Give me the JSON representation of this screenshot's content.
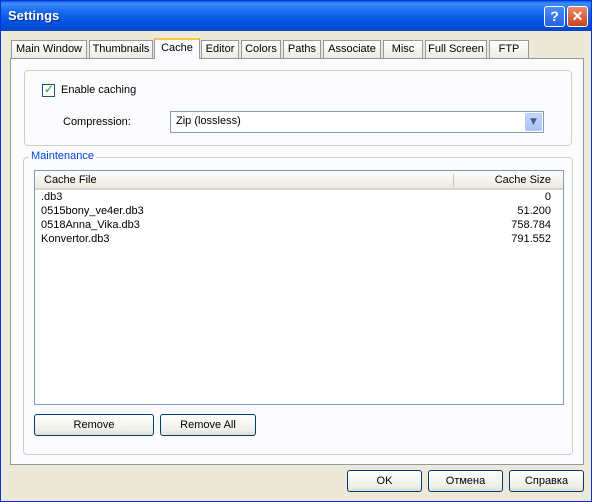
{
  "window": {
    "title": "Settings",
    "help_glyph": "?",
    "close_glyph": "✕"
  },
  "tabs": [
    {
      "label": "Main Window"
    },
    {
      "label": "Thumbnails"
    },
    {
      "label": "Cache"
    },
    {
      "label": "Editor"
    },
    {
      "label": "Colors"
    },
    {
      "label": "Paths"
    },
    {
      "label": "Associate"
    },
    {
      "label": "Misc"
    },
    {
      "label": "Full Screen"
    },
    {
      "label": "FTP"
    }
  ],
  "active_tab": "Cache",
  "cache": {
    "enable_label": "Enable caching",
    "enable_checked": true,
    "compression_label": "Compression:",
    "compression_value": "Zip (lossless)"
  },
  "maintenance": {
    "legend": "Maintenance",
    "col_file": "Cache File",
    "col_size": "Cache Size",
    "rows": [
      {
        "file": ".db3",
        "size": "0"
      },
      {
        "file": "0515bony_ve4er.db3",
        "size": "51.200"
      },
      {
        "file": "0518Anna_Vika.db3",
        "size": "758.784"
      },
      {
        "file": "Konvertor.db3",
        "size": "791.552"
      }
    ],
    "remove_label": "Remove",
    "remove_all_label": "Remove All"
  },
  "footer": {
    "ok_label": "OK",
    "cancel_label": "Отмена",
    "help_label": "Справка"
  },
  "colors": {
    "titlebar": "#0053E1",
    "legend": "#0046D5",
    "active_tab_highlight": "#FFC83C"
  }
}
